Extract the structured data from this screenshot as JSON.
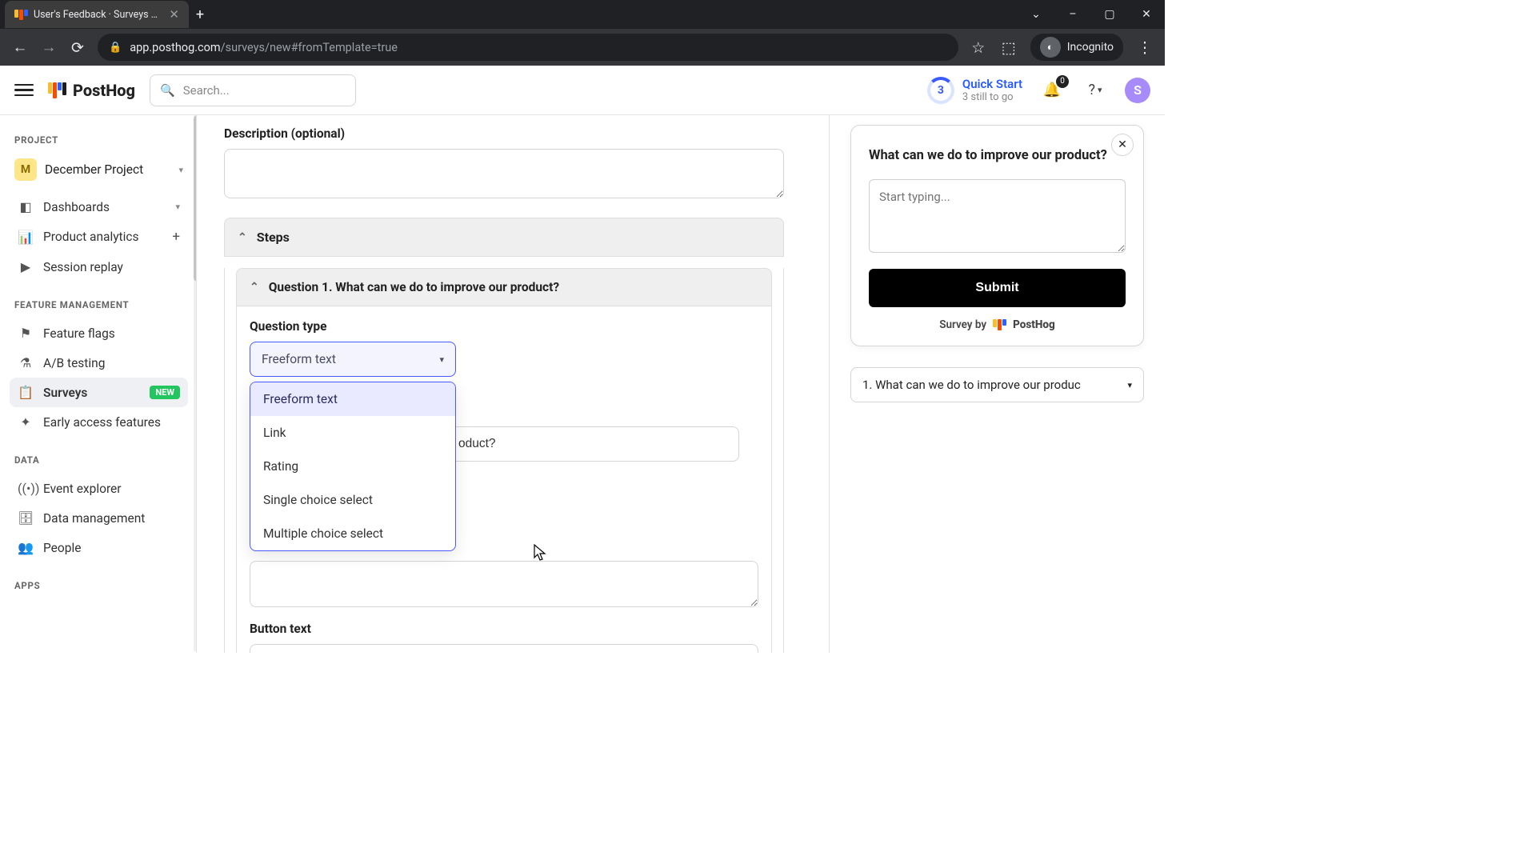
{
  "browser": {
    "tab_title": "User's Feedback · Surveys · Post",
    "url_host": "app.posthog.com",
    "url_path": "/surveys/new#fromTemplate=true",
    "incognito_label": "Incognito",
    "window_min": "–",
    "window_max": "▢",
    "window_close": "✕"
  },
  "header": {
    "logo_text": "PostHog",
    "search_placeholder": "Search...",
    "quickstart_count": "3",
    "quickstart_title": "Quick Start",
    "quickstart_sub": "3 still to go",
    "notif_count": "0",
    "user_initial": "S"
  },
  "sidebar": {
    "sections": {
      "project": "PROJECT",
      "feature": "FEATURE MANAGEMENT",
      "data": "DATA",
      "apps": "APPS"
    },
    "project_badge": "M",
    "project_name": "December Project",
    "items": {
      "dashboards": "Dashboards",
      "analytics": "Product analytics",
      "replay": "Session replay",
      "flags": "Feature flags",
      "ab": "A/B testing",
      "surveys": "Surveys",
      "surveys_badge": "NEW",
      "early": "Early access features",
      "events": "Event explorer",
      "data_mgmt": "Data management",
      "people": "People"
    }
  },
  "form": {
    "desc_label": "Description (optional)",
    "desc_value": "",
    "steps_label": "Steps",
    "q1_header": "Question 1. What can we do to improve our product?",
    "qtype_label": "Question type",
    "qtype_selected": "Freeform text",
    "qtype_options": [
      "Freeform text",
      "Link",
      "Rating",
      "Single choice select",
      "Multiple choice select"
    ],
    "question_value_partial": "oduct?",
    "button_text_label": "Button text"
  },
  "preview": {
    "question": "What can we do to improve our product?",
    "placeholder": "Start typing...",
    "submit": "Submit",
    "brand_prefix": "Survey by",
    "brand_name": "PostHog",
    "selector_text": "1. What can we do to improve our produc"
  }
}
